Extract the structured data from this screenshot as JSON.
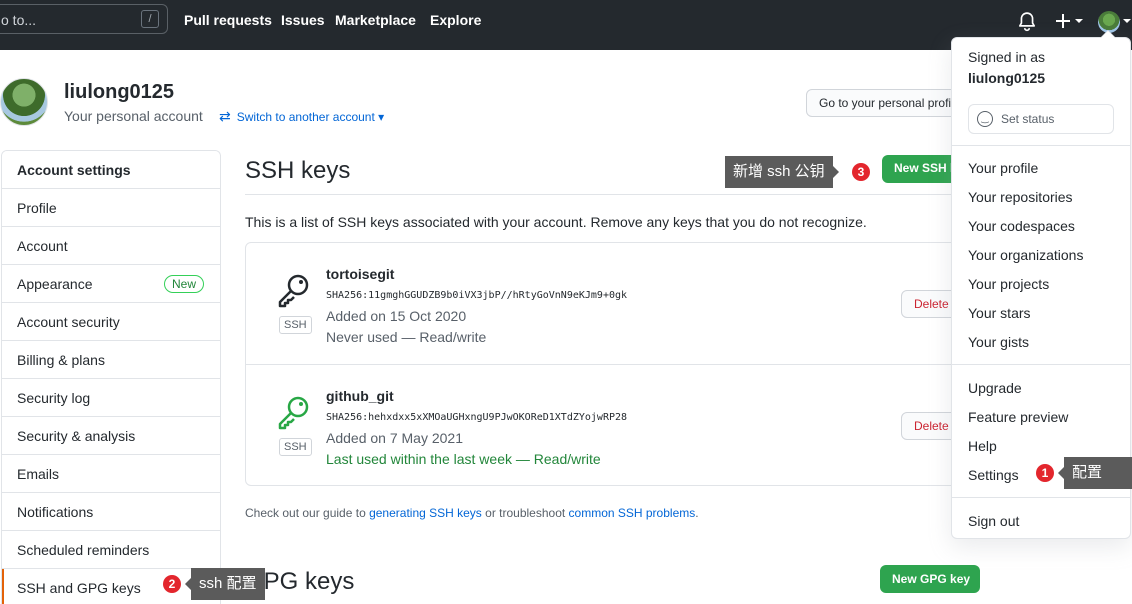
{
  "header": {
    "search_text": "o to...",
    "search_shortcut": "/",
    "nav": [
      "Pull requests",
      "Issues",
      "Marketplace",
      "Explore"
    ],
    "icons": [
      "bell-icon",
      "plus-icon",
      "avatar"
    ]
  },
  "profile": {
    "username": "liulong0125",
    "subtitle": "Your personal account",
    "switch_label": "Switch to another account",
    "goto_label": "Go to your personal profile"
  },
  "sidebar": {
    "heading": "Account settings",
    "items": [
      {
        "label": "Profile"
      },
      {
        "label": "Account"
      },
      {
        "label": "Appearance",
        "badge": "New"
      },
      {
        "label": "Account security"
      },
      {
        "label": "Billing & plans"
      },
      {
        "label": "Security log"
      },
      {
        "label": "Security & analysis"
      },
      {
        "label": "Emails"
      },
      {
        "label": "Notifications"
      },
      {
        "label": "Scheduled reminders"
      },
      {
        "label": "SSH and GPG keys"
      }
    ]
  },
  "main": {
    "title": "SSH keys",
    "new_ssh_label": "New SSH key",
    "description": "This is a list of SSH keys associated with your account. Remove any keys that you do not recognize.",
    "keys": [
      {
        "name": "tortoisegit",
        "fingerprint": "SHA256:11gmghGGUDZB9b0iVX3jbP//hRtyGoVnN9eKJm9+0gk",
        "added": "Added on 15 Oct 2020",
        "usage": "Never used — Read/write",
        "type_label": "SSH",
        "delete_label": "Delete",
        "icon_color": "#24292e"
      },
      {
        "name": "github_git",
        "fingerprint": "SHA256:hehxdxx5xXMOaUGHxngU9PJwOKOReD1XTdZYojwRP28",
        "added": "Added on 7 May 2021",
        "usage": "Last used within the last week — Read/write",
        "type_label": "SSH",
        "delete_label": "Delete",
        "icon_color": "#28a745"
      }
    ],
    "guide_prefix": "Check out our guide to ",
    "guide_link1": "generating SSH keys",
    "guide_mid": " or troubleshoot ",
    "guide_link2": "common SSH problems",
    "guide_suffix": ".",
    "gpg_title": "GPG keys",
    "new_gpg_label": "New GPG key"
  },
  "dropdown": {
    "signed_in_as": "Signed in as",
    "username": "liulong0125",
    "set_status": "Set status",
    "group1": [
      "Your profile",
      "Your repositories",
      "Your codespaces",
      "Your organizations",
      "Your projects",
      "Your stars",
      "Your gists"
    ],
    "group2": [
      "Upgrade",
      "Feature preview",
      "Help",
      "Settings"
    ],
    "sign_out": "Sign out"
  },
  "annotations": [
    {
      "number": "1",
      "text": "配置"
    },
    {
      "number": "2",
      "text": "ssh 配置"
    },
    {
      "number": "3",
      "text": "新增 ssh 公钥"
    }
  ],
  "colors": {
    "header_bg": "#24292e",
    "primary_green": "#2ea44f",
    "link_blue": "#0366d6",
    "danger_red": "#cb2431",
    "annotation_red": "#e3262d",
    "callout_gray": "#5b5b5b"
  }
}
